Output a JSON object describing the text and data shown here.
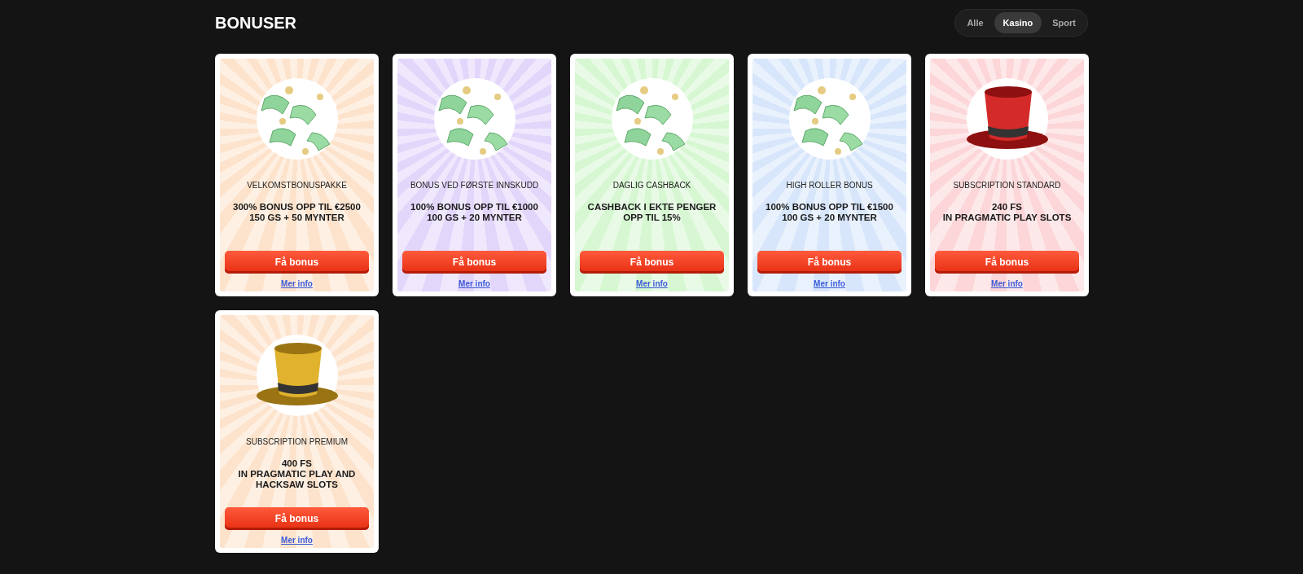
{
  "page": {
    "title": "BONUSER"
  },
  "tabs": [
    {
      "label": "Alle",
      "selected": false
    },
    {
      "label": "Kasino",
      "selected": true
    },
    {
      "label": "Sport",
      "selected": false
    }
  ],
  "cards": [
    {
      "kind": "cash",
      "color": "#fde3cc",
      "name": "VELKOMSTBONUSPAKKE",
      "offer": [
        "300% BONUS OPP TIL €2500",
        "150 GS + 50 MYNTER"
      ],
      "button": "Få bonus",
      "link": "Mer info"
    },
    {
      "kind": "cash",
      "color": "#e3d6fb",
      "name": "BONUS VED FØRSTE INNSKUDD",
      "offer": [
        "100% BONUS OPP TIL €1000",
        "100 GS + 20 MYNTER"
      ],
      "button": "Få bonus",
      "link": "Mer info"
    },
    {
      "kind": "cash",
      "color": "#d6f7d2",
      "name": "DAGLIG CASHBACK",
      "offer": [
        "CASHBACK I EKTE PENGER",
        "OPP TIL 15%"
      ],
      "button": "Få bonus",
      "link": "Mer info"
    },
    {
      "kind": "cash",
      "color": "#d7e6fb",
      "name": "HIGH ROLLER BONUS",
      "offer": [
        "100% BONUS OPP TIL €1500",
        "100 GS + 20 MYNTER"
      ],
      "button": "Få bonus",
      "link": "Mer info"
    },
    {
      "kind": "red_hat",
      "color": "#fcd6d8",
      "name": "SUBSCRIPTION STANDARD",
      "offer": [
        "240 FS",
        "IN PRAGMATIC PLAY SLOTS"
      ],
      "button": "Få bonus",
      "link": "Mer info"
    },
    {
      "kind": "gold_hat",
      "color": "#fde3cc",
      "name": "SUBSCRIPTION PREMIUM",
      "offer": [
        "400 FS",
        "IN PRAGMATIC PLAY AND",
        "HACKSAW SLOTS"
      ],
      "button": "Få bonus",
      "link": "Mer info"
    }
  ]
}
